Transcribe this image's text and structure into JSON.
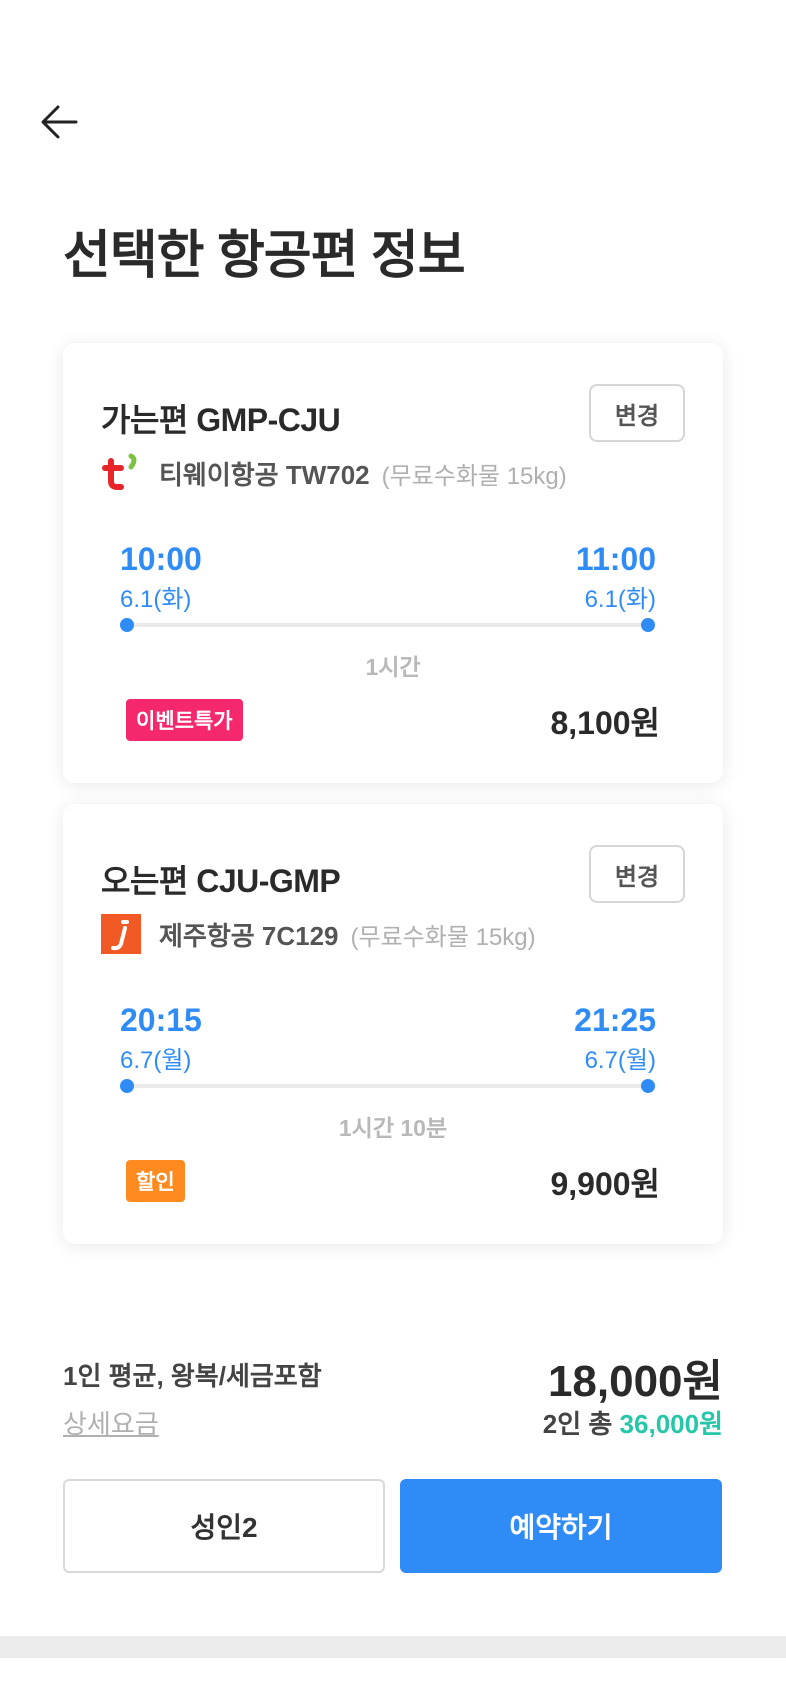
{
  "page": {
    "title": "선택한 항공편 정보"
  },
  "flights": [
    {
      "title": "가는편 GMP-CJU",
      "change_label": "변경",
      "airline_icon": "tway-logo-icon",
      "airline": "티웨이항공 TW702",
      "baggage": "(무료수화물 15kg)",
      "departure_time": "10:00",
      "departure_date": "6.1(화)",
      "arrival_time": "11:00",
      "arrival_date": "6.1(화)",
      "duration": "1시간",
      "tag": "이벤트특가",
      "tag_color": "#f5286e",
      "price": "8,100원"
    },
    {
      "title": "오는편 CJU-GMP",
      "change_label": "변경",
      "airline_icon": "jeju-air-logo-icon",
      "airline": "제주항공 7C129",
      "baggage": "(무료수화물 15kg)",
      "departure_time": "20:15",
      "departure_date": "6.7(월)",
      "arrival_time": "21:25",
      "arrival_date": "6.7(월)",
      "duration": "1시간 10분",
      "tag": "할인",
      "tag_color": "#ff8a1f",
      "price": "9,900원"
    }
  ],
  "summary": {
    "label": "1인 평균, 왕복/세금포함",
    "detail_link": "상세요금",
    "avg_price": "18,000원",
    "total_prefix": "2인 총",
    "total_value": "36,000원"
  },
  "actions": {
    "passenger_label": "성인2",
    "book_label": "예약하기"
  },
  "colors": {
    "accent": "#2f8cf7",
    "total": "#26c6a8"
  }
}
